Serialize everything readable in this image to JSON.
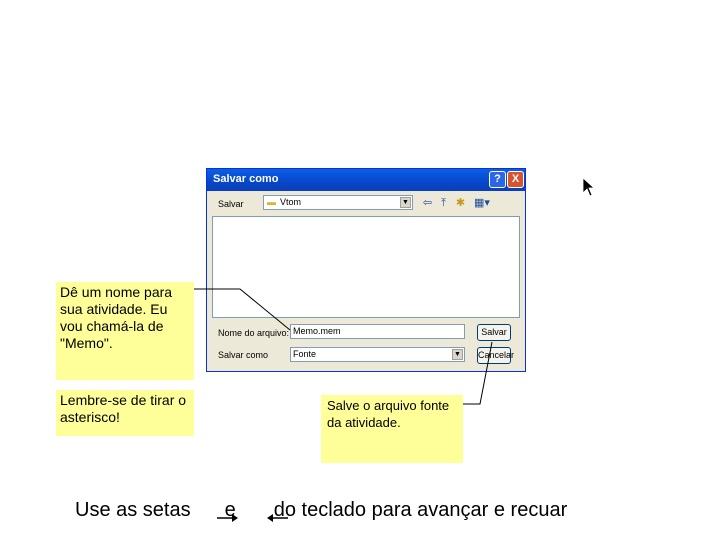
{
  "dialog": {
    "title": "Salvar como",
    "help_btn": "?",
    "close_btn": "X",
    "save_in_label": "Salvar",
    "save_in_value": "Vtom",
    "filename_label": "Nome do arquivo:",
    "filename_value": "Memo.mem",
    "filetype_label": "Salvar como",
    "filetype_value": "Fonte",
    "save_button": "Salvar",
    "cancel_button": "Cancelar"
  },
  "notes": {
    "name_note": "Dê um nome para sua atividade. Eu vou chamá-la de \"Memo\".",
    "asterisk_note": "Lembre-se de tirar o asterisco!",
    "save_note": "Salve o arquivo fonte da atividade."
  },
  "footer": {
    "part1": "Use as setas",
    "part2": "e",
    "part3": "do teclado para avançar e recuar"
  },
  "icons": {
    "back": "back-arrow-icon",
    "up": "up-folder-icon",
    "new_folder": "new-folder-icon",
    "views": "views-menu-icon",
    "cursor": "mouse-pointer-icon"
  },
  "colors": {
    "note_bg": "#ffff99",
    "titlebar": "#0846c8",
    "dialog_bg": "#ece9d8"
  }
}
